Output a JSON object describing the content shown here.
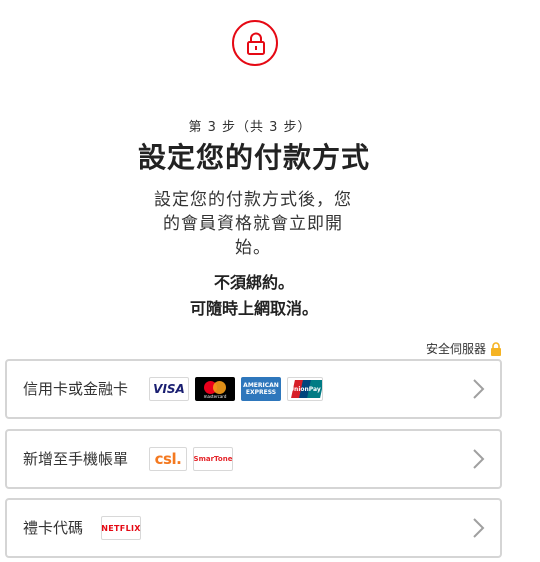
{
  "header": {
    "lock_icon": "lock-icon",
    "accent_color": "#e50914",
    "step": "第 3 步（共 3 步）",
    "title": "設定您的付款方式",
    "description": "設定您的付款方式後，您的會員資格就會立即開始。",
    "note_line1": "不須綁約。",
    "note_line2": "可隨時上網取消。"
  },
  "secure_server": {
    "label": "安全伺服器",
    "icon": "padlock-icon",
    "icon_color": "#f5b323"
  },
  "payment_options": [
    {
      "label": "信用卡或金融卡",
      "logos": {
        "visa": "VISA",
        "mastercard": "mastercard",
        "amex_line1": "AMERICAN",
        "amex_line2": "EXPRESS",
        "unionpay": "UnionPay"
      }
    },
    {
      "label": "新增至手機帳單",
      "logos": {
        "csl": "csl.",
        "smartone": "SmarTone"
      }
    },
    {
      "label": "禮卡代碼",
      "logos": {
        "netflix": "NETFLIX"
      }
    }
  ]
}
